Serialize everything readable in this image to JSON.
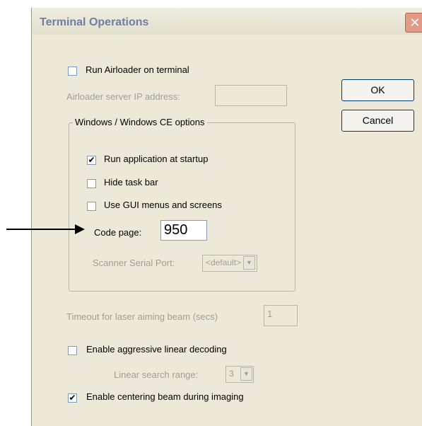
{
  "dialog": {
    "title": "Terminal Operations",
    "close_glyph": "✕"
  },
  "airloader": {
    "run_label": "Run Airloader on terminal",
    "run_checked": false,
    "ip_label": "Airloader server IP address:",
    "ip_value": ""
  },
  "buttons": {
    "ok": "OK",
    "cancel": "Cancel"
  },
  "windows_group": {
    "legend": "Windows / Windows CE options",
    "run_startup_label": "Run application at startup",
    "run_startup_checked": true,
    "hide_taskbar_label": "Hide task bar",
    "hide_taskbar_checked": false,
    "gui_menus_label": "Use GUI menus and screens",
    "gui_menus_checked": false,
    "code_page_label": "Code page:",
    "code_page_value": "950",
    "scanner_port_label": "Scanner Serial Port:",
    "scanner_port_value": "<default>"
  },
  "laser": {
    "timeout_label": "Timeout for laser aiming beam (secs)",
    "timeout_value": "1"
  },
  "decoding": {
    "aggressive_label": "Enable aggressive linear decoding",
    "aggressive_checked": false,
    "search_range_label": "Linear search range:",
    "search_range_value": "3",
    "centering_label": "Enable centering beam during imaging",
    "centering_checked": true
  },
  "icons": {
    "check_glyph": "✔",
    "dropdown_glyph": "▼"
  }
}
